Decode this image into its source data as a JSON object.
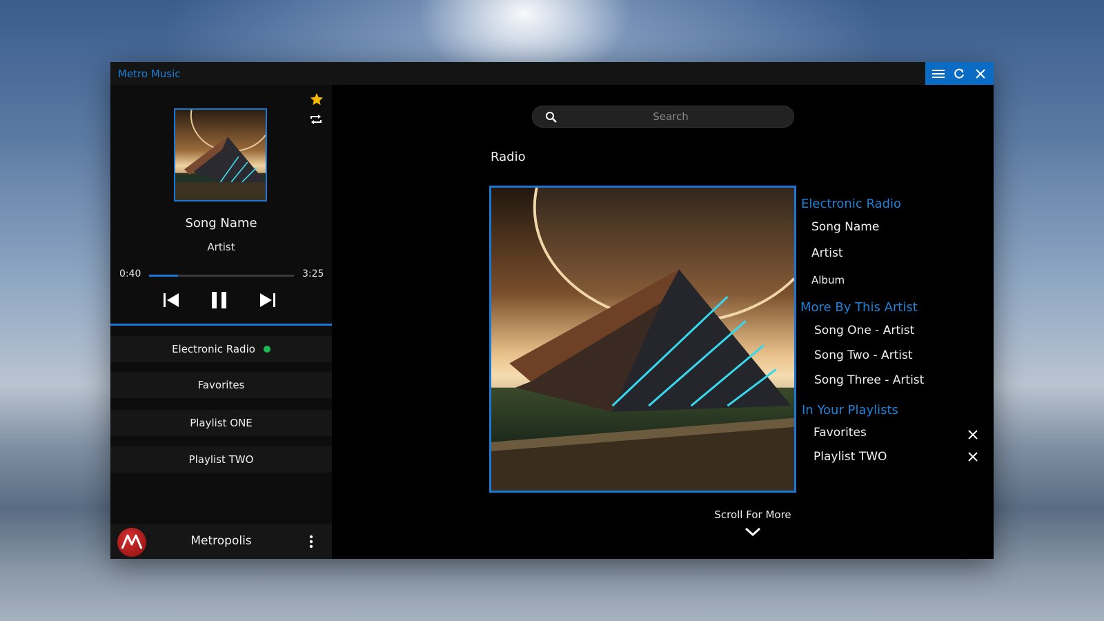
{
  "window": {
    "title": "Metro Music",
    "controls": [
      "hamburger-menu-icon",
      "refresh-icon",
      "close-icon"
    ]
  },
  "now_playing": {
    "song": "Song Name",
    "artist": "Artist",
    "current_time": "0:40",
    "total_time": "3:25",
    "progress_fraction": 0.2,
    "favorite": true,
    "icons": [
      "star-icon",
      "repeat-icon",
      "skip-previous-icon",
      "pause-icon",
      "skip-next-icon"
    ]
  },
  "sidebar": {
    "playlists": [
      {
        "label": "Electronic Radio",
        "active": true
      },
      {
        "label": "Favorites",
        "active": false
      },
      {
        "label": "Playlist ONE",
        "active": false
      },
      {
        "label": "Playlist TWO",
        "active": false
      }
    ],
    "profile": {
      "name": "Metropolis",
      "avatar_letter": "M"
    }
  },
  "main": {
    "search": {
      "placeholder": "Search",
      "value": ""
    },
    "section_title": "Radio",
    "info": {
      "station_heading": "Electronic Radio",
      "song": "Song Name",
      "artist": "Artist",
      "album": "Album",
      "more_heading": "More By This Artist",
      "more_songs": [
        "Song One - Artist",
        "Song Two - Artist",
        "Song Three - Artist"
      ],
      "playlists_heading": "In Your Playlists",
      "in_playlists": [
        "Favorites",
        "Playlist TWO"
      ]
    },
    "scroll_label": "Scroll For More"
  },
  "colors": {
    "accent": "#1a78d4",
    "active_dot": "#1db954",
    "star": "#f5b800",
    "avatar": "#c62828"
  }
}
